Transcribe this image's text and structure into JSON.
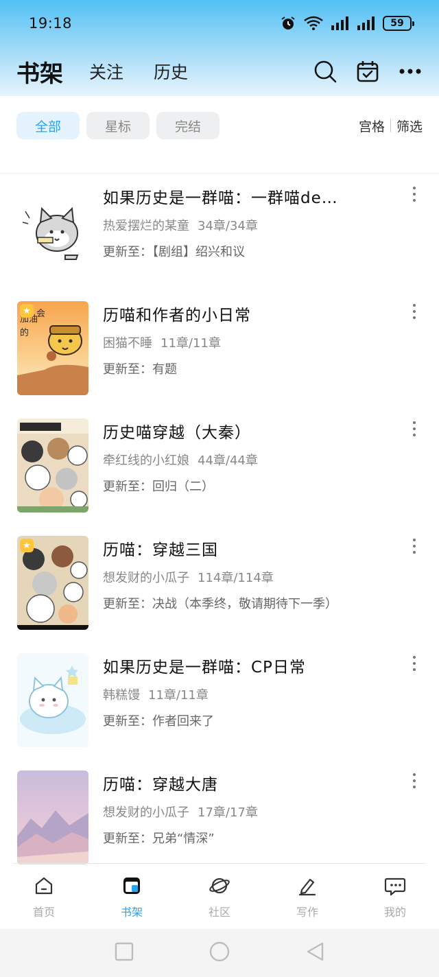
{
  "status_bar": {
    "time": "19:18",
    "battery": "59"
  },
  "header": {
    "tabs": [
      {
        "label": "书架",
        "active": true
      },
      {
        "label": "关注",
        "active": false
      },
      {
        "label": "历史",
        "active": false
      }
    ],
    "actions": [
      "search-icon",
      "calendar-check-icon",
      "more-horizontal-icon"
    ]
  },
  "filters": {
    "chips": [
      {
        "label": "全部",
        "active": true
      },
      {
        "label": "星标",
        "active": false
      },
      {
        "label": "完结",
        "active": false
      }
    ],
    "view_grid": "宫格",
    "view_filter": "筛选"
  },
  "books": [
    {
      "title": "如果历史是一群喵：一群喵de…",
      "author": "热爱摆烂的某童",
      "chapters": "34章/34章",
      "update_prefix": "更新至：",
      "update": "【剧组】绍兴和议",
      "starred": false,
      "cover_colors": [
        "#ffffff",
        "#d9d9d9"
      ]
    },
    {
      "title": "历喵和作者的小日常",
      "author": "困猫不睡",
      "chapters": "11章/11章",
      "update_prefix": "更新至：",
      "update": "有题",
      "starred": true,
      "cover_text": "加油的会",
      "cover_colors": [
        "#f6a04d",
        "#fbe0b3"
      ]
    },
    {
      "title": "历史喵穿越（大秦）",
      "author": "牵红线的小红娘",
      "chapters": "44章/44章",
      "update_prefix": "更新至：",
      "update": "回归（二）",
      "starred": false,
      "cover_colors": [
        "#8db27a",
        "#f3e7d3"
      ]
    },
    {
      "title": "历喵：穿越三国",
      "author": "想发财的小瓜子",
      "chapters": "114章/114章",
      "update_prefix": "更新至：",
      "update": "决战（本季终，敬请期待下一季）",
      "starred": true,
      "cover_colors": [
        "#7a9a5f",
        "#efe2c8"
      ]
    },
    {
      "title": "如果历史是一群喵：CP日常",
      "author": "韩糕馒",
      "chapters": "11章/11章",
      "update_prefix": "更新至：",
      "update": "作者回来了",
      "starred": false,
      "cover_colors": [
        "#dff2fb",
        "#b9e2f2"
      ]
    },
    {
      "title": "历喵：穿越大唐",
      "author": "想发财的小瓜子",
      "chapters": "17章/17章",
      "update_prefix": "更新至：",
      "update": "兄弟“情深”",
      "starred": false,
      "cover_colors": [
        "#c7b7d6",
        "#f1c9c4"
      ]
    }
  ],
  "bottom_nav": [
    {
      "label": "首页",
      "icon": "home-icon",
      "active": false
    },
    {
      "label": "书架",
      "icon": "bookshelf-icon",
      "active": true
    },
    {
      "label": "社区",
      "icon": "planet-icon",
      "active": false
    },
    {
      "label": "写作",
      "icon": "pen-icon",
      "active": false
    },
    {
      "label": "我的",
      "icon": "chat-bubble-icon",
      "active": false
    }
  ],
  "colors": {
    "accent": "#2aa3f0",
    "header_gradient_top": "#52c1f5",
    "chip_bg": "#eeeff1"
  }
}
